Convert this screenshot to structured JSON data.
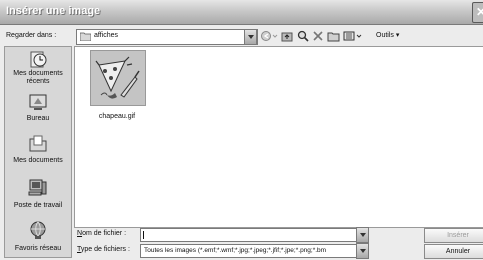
{
  "window": {
    "title": "Insérer une image"
  },
  "lookin": {
    "label": "Regarder dans :",
    "value": "affiches"
  },
  "toolbar": {
    "tools_label": "Outils"
  },
  "places": [
    {
      "label": "Mes documents récents"
    },
    {
      "label": "Bureau"
    },
    {
      "label": "Mes documents"
    },
    {
      "label": "Poste de travail"
    },
    {
      "label": "Favoris réseau"
    }
  ],
  "files": [
    {
      "name": "chapeau.gif"
    }
  ],
  "filename": {
    "label": "Nom de fichier :",
    "value": ""
  },
  "filetype": {
    "label": "Type de fichiers :",
    "value": "Toutes les images (*.emf;*.wmf;*.jpg;*.jpeg;*.jfif;*.jpe;*.png;*.bm"
  },
  "buttons": {
    "insert": "Insérer",
    "cancel": "Annuler"
  }
}
